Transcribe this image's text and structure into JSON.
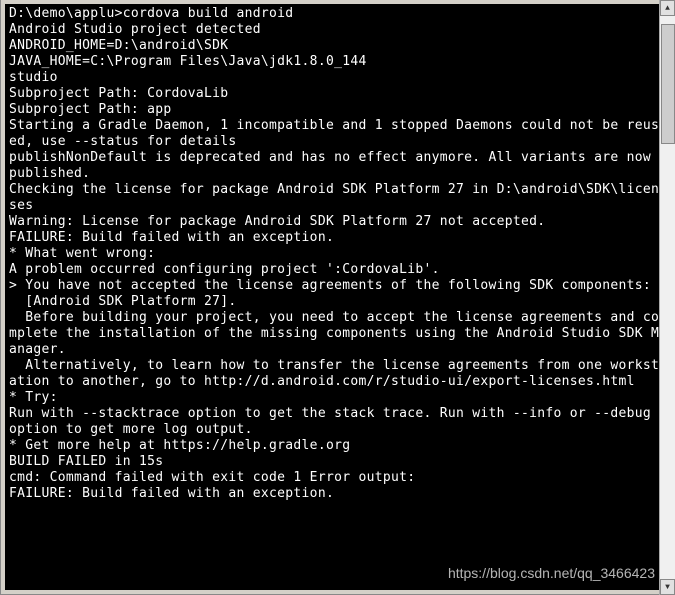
{
  "terminal": {
    "lines": [
      "D:\\demo\\applu>cordova build android",
      "Android Studio project detected",
      "ANDROID_HOME=D:\\android\\SDK",
      "JAVA_HOME=C:\\Program Files\\Java\\jdk1.8.0_144",
      "studio",
      "Subproject Path: CordovaLib",
      "Subproject Path: app",
      "Starting a Gradle Daemon, 1 incompatible and 1 stopped Daemons could not be reused, use --status for details",
      "publishNonDefault is deprecated and has no effect anymore. All variants are now published.",
      "Checking the license for package Android SDK Platform 27 in D:\\android\\SDK\\licenses",
      "Warning: License for package Android SDK Platform 27 not accepted.",
      "",
      "FAILURE: Build failed with an exception.",
      "",
      "* What went wrong:",
      "A problem occurred configuring project ':CordovaLib'.",
      "> You have not accepted the license agreements of the following SDK components:",
      "  [Android SDK Platform 27].",
      "  Before building your project, you need to accept the license agreements and complete the installation of the missing components using the Android Studio SDK Manager.",
      "  Alternatively, to learn how to transfer the license agreements from one workstation to another, go to http://d.android.com/r/studio-ui/export-licenses.html",
      "",
      "* Try:",
      "Run with --stacktrace option to get the stack trace. Run with --info or --debug option to get more log output.",
      "",
      "* Get more help at https://help.gradle.org",
      "",
      "BUILD FAILED in 15s",
      "cmd: Command failed with exit code 1 Error output:",
      "FAILURE: Build failed with an exception."
    ]
  },
  "watermark": "https://blog.csdn.net/qq_3466423"
}
